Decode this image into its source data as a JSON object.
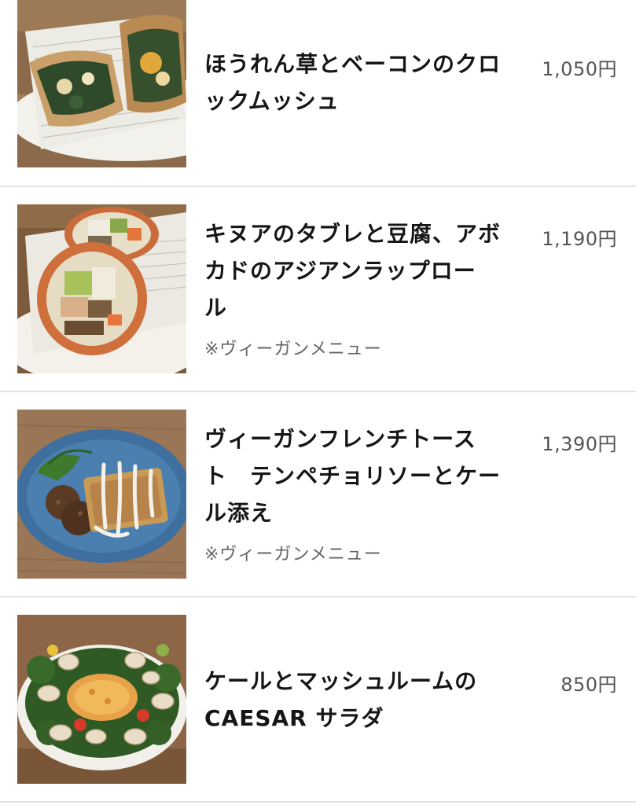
{
  "menu": {
    "items": [
      {
        "title": "ほうれん草とベーコンのクロ\nックムッシュ",
        "price": "1,050円",
        "note": ""
      },
      {
        "title": "キヌアのタブレと豆腐、アボ\nカドのアジアンラップロー\nル",
        "price": "1,190円",
        "note": "※ヴィーガンメニュー"
      },
      {
        "title": "ヴィーガンフレンチトース\nト　テンペチョリソーとケー\nル添え",
        "price": "1,390円",
        "note": "※ヴィーガンメニュー"
      },
      {
        "title": "ケールとマッシュルームの\nCAESAR サラダ",
        "price": "850円",
        "note": ""
      }
    ]
  }
}
